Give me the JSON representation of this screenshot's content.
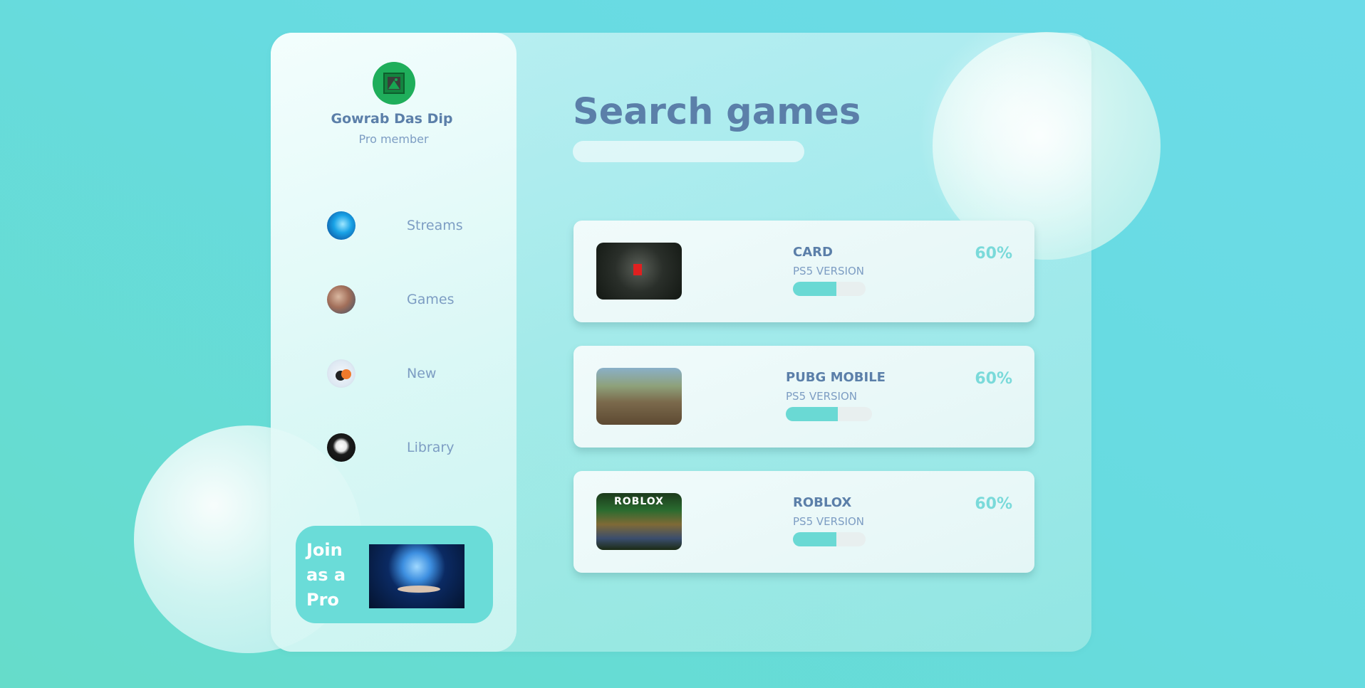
{
  "profile": {
    "name": "Gowrab Das Dip",
    "role": "Pro member"
  },
  "sidebar": {
    "items": [
      {
        "label": "Streams",
        "icon": "streams-avatar"
      },
      {
        "label": "Games",
        "icon": "games-avatar"
      },
      {
        "label": "New",
        "icon": "new-avatar"
      },
      {
        "label": "Library",
        "icon": "library-avatar"
      }
    ]
  },
  "promo": {
    "label": "Join as a Pro",
    "image": "brain-hologram-image"
  },
  "main": {
    "title": "Search games",
    "search": {
      "value": "",
      "placeholder": ""
    }
  },
  "games": [
    {
      "name": "CARD",
      "version": "PS5 VERSION",
      "percent_label": "60%",
      "progress": 0.6,
      "thumbnail": "card-thumbnail"
    },
    {
      "name": "PUBG MOBILE",
      "version": "PS5 VERSION",
      "percent_label": "60%",
      "progress": 0.6,
      "thumbnail": "pubg-thumbnail"
    },
    {
      "name": "ROBLOX",
      "version": "PS5 VERSION",
      "percent_label": "60%",
      "progress": 0.6,
      "thumbnail": "roblox-thumbnail",
      "thumbnail_text": "ROBLOX"
    }
  ],
  "colors": {
    "background": "#67dbe0",
    "text_primary": "#5b7fa9",
    "text_secondary": "#7d9dc3",
    "accent": "#6ad9d4",
    "avatar": "#1fae5b"
  }
}
